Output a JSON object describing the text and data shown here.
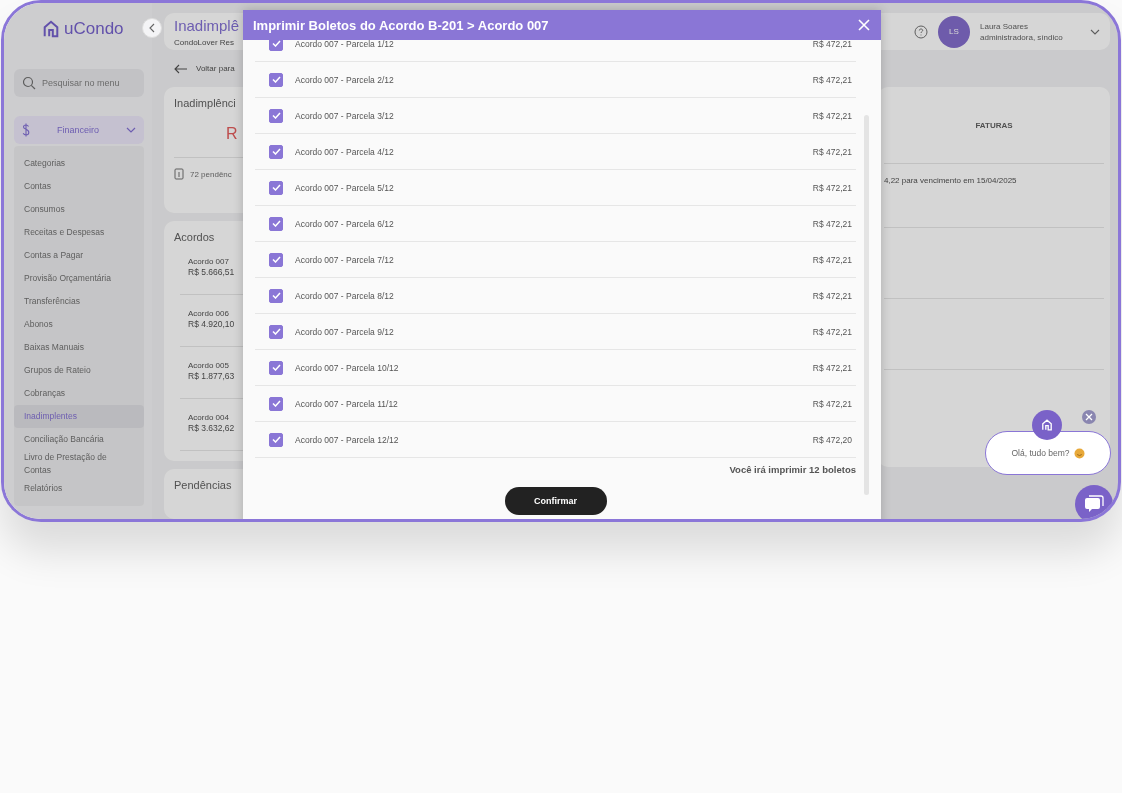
{
  "sidebar": {
    "logo": "uCondo",
    "search": {
      "placeholder": "Pesquisar no menu"
    },
    "sections": [
      {
        "label": "Financeiro",
        "expanded": true,
        "children": [
          {
            "label": "Categorias",
            "selected": false
          },
          {
            "label": "Contas",
            "selected": false
          },
          {
            "label": "Consumos",
            "selected": false
          },
          {
            "label": "Receitas e Despesas",
            "selected": false
          },
          {
            "label": "Contas a Pagar",
            "selected": false
          },
          {
            "label": "Provisão Orçamentária",
            "selected": false
          },
          {
            "label": "Transferências",
            "selected": false
          },
          {
            "label": "Abonos",
            "selected": false
          },
          {
            "label": "Baixas Manuais",
            "selected": false
          },
          {
            "label": "Grupos de Rateio",
            "selected": false
          },
          {
            "label": "Cobranças",
            "selected": false
          },
          {
            "label": "Inadimplentes",
            "selected": true
          },
          {
            "label": "Conciliação Bancária",
            "selected": false
          },
          {
            "label": "Livro de Prestação de Contas",
            "selected": false
          },
          {
            "label": "Relatórios",
            "selected": false
          }
        ]
      }
    ]
  },
  "header": {
    "title": "Inadimplê",
    "subtitle": "CondoLover Res",
    "user": {
      "initials": "LS",
      "name": "Laura Soares",
      "role": "administradora, síndico"
    }
  },
  "back_link": "Voltar para",
  "summary": {
    "title": "Inadimplênci",
    "value": "R",
    "pending": "72 pendênc"
  },
  "agreements": {
    "title": "Acordos",
    "items": [
      {
        "name": "Acordo 007",
        "amount": "R$ 5.666,51"
      },
      {
        "name": "Acordo 006",
        "amount": "R$ 4.920,10"
      },
      {
        "name": "Acordo 005",
        "amount": "R$ 1.877,63"
      },
      {
        "name": "Acordo 004",
        "amount": "R$ 3.632,62"
      }
    ]
  },
  "pending_title": "Pendências",
  "invoices": {
    "title": "FATURAS",
    "rows": [
      "4,22 para vencimento em 15/04/2025"
    ]
  },
  "modal": {
    "title": "Imprimir Boletos do Acordo B-201 > Acordo 007",
    "rows": [
      {
        "label": "Acordo 007 - Parcela 1/12",
        "amount": "R$ 472,21",
        "checked": true
      },
      {
        "label": "Acordo 007 - Parcela 2/12",
        "amount": "R$ 472,21",
        "checked": true
      },
      {
        "label": "Acordo 007 - Parcela 3/12",
        "amount": "R$ 472,21",
        "checked": true
      },
      {
        "label": "Acordo 007 - Parcela 4/12",
        "amount": "R$ 472,21",
        "checked": true
      },
      {
        "label": "Acordo 007 - Parcela 5/12",
        "amount": "R$ 472,21",
        "checked": true
      },
      {
        "label": "Acordo 007 - Parcela 6/12",
        "amount": "R$ 472,21",
        "checked": true
      },
      {
        "label": "Acordo 007 - Parcela 7/12",
        "amount": "R$ 472,21",
        "checked": true
      },
      {
        "label": "Acordo 007 - Parcela 8/12",
        "amount": "R$ 472,21",
        "checked": true
      },
      {
        "label": "Acordo 007 - Parcela 9/12",
        "amount": "R$ 472,21",
        "checked": true
      },
      {
        "label": "Acordo 007 - Parcela 10/12",
        "amount": "R$ 472,21",
        "checked": true
      },
      {
        "label": "Acordo 007 - Parcela 11/12",
        "amount": "R$ 472,21",
        "checked": true
      },
      {
        "label": "Acordo 007 - Parcela 12/12",
        "amount": "R$ 472,20",
        "checked": true
      }
    ],
    "summary": "Você irá imprimir 12 boletos",
    "confirm": "Confirmar"
  },
  "chat": {
    "message": "Olá, tudo bem?"
  }
}
